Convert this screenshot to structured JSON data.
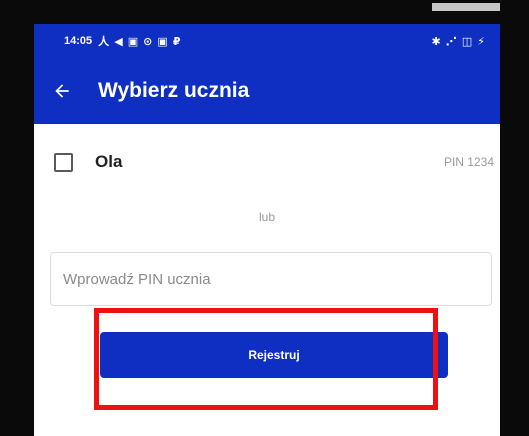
{
  "status_bar": {
    "time": "14:05",
    "left_icons": "人 ◀ ▣ ⊙ ▣ ₽",
    "right_icons": "✱ ⋰ ◫ ⚡"
  },
  "app_bar": {
    "title": "Wybierz ucznia",
    "back_icon": "arrow-left-icon"
  },
  "student": {
    "name": "Ola",
    "pin": "PIN 1234"
  },
  "or_label": "lub",
  "pin_input": {
    "placeholder": "Wprowadź PIN ucznia",
    "value": ""
  },
  "register_button": {
    "label": "Rejestruj"
  },
  "colors": {
    "primary": "#0f2fc2",
    "highlight": "#ee1111"
  }
}
